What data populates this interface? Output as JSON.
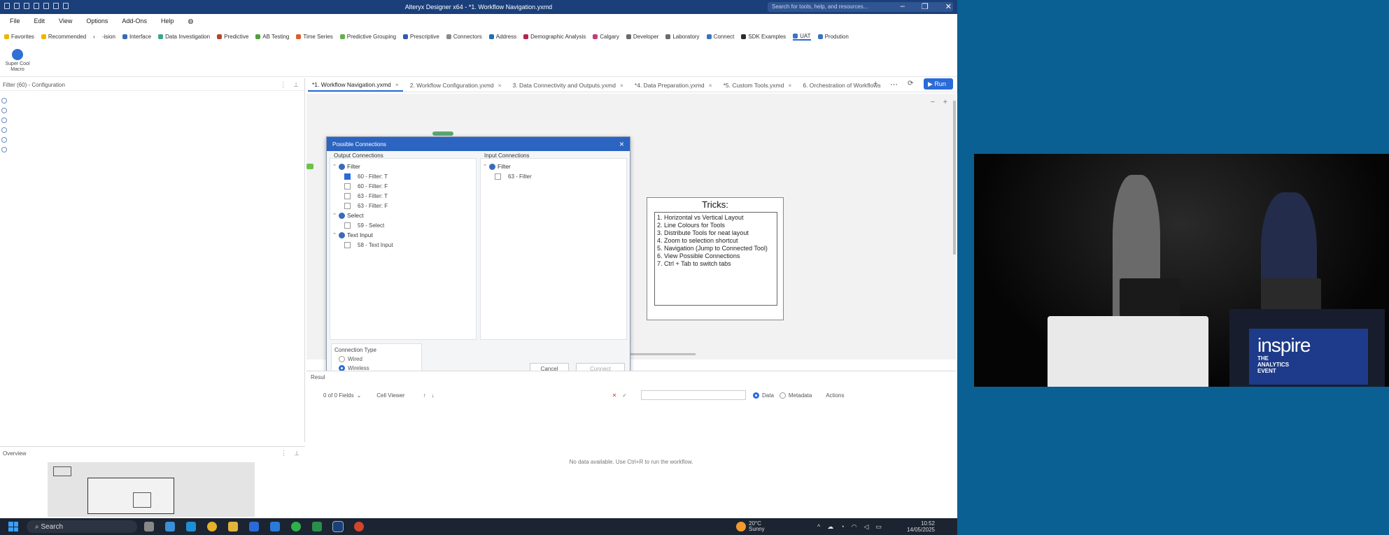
{
  "app": {
    "title": "Alteryx Designer x64 - *1. Workflow Navigation.yxmd",
    "search_placeholder": "Search for tools, help, and resources...",
    "window_controls": [
      "–",
      "❐",
      "✕"
    ]
  },
  "menu": [
    "File",
    "Edit",
    "View",
    "Options",
    "Add-Ons",
    "Help"
  ],
  "categories": [
    {
      "label": "Favorites",
      "color": "#f0b400"
    },
    {
      "label": "Recommended",
      "color": "#f0b400"
    },
    {
      "label": "‹"
    },
    {
      "label": "-ision",
      "color": ""
    },
    {
      "label": "Interface",
      "color": "#3b6bb8"
    },
    {
      "label": "Data Investigation",
      "color": "#3aa68c"
    },
    {
      "label": "Predictive",
      "color": "#b5462a"
    },
    {
      "label": "AB Testing",
      "color": "#4fa13a"
    },
    {
      "label": "Time Series",
      "color": "#e05a2b"
    },
    {
      "label": "Predictive Grouping",
      "color": "#62b04b"
    },
    {
      "label": "Prescriptive",
      "color": "#3556b8"
    },
    {
      "label": "Connectors",
      "color": "#8a8a8a"
    },
    {
      "label": "Address",
      "color": "#1f6fb0"
    },
    {
      "label": "Demographic Analysis",
      "color": "#b8234a"
    },
    {
      "label": "Calgary",
      "color": "#c13f7c"
    },
    {
      "label": "Developer",
      "color": "#6b6b6b"
    },
    {
      "label": "Laboratory",
      "color": "#6b6b6b"
    },
    {
      "label": "Connect",
      "color": "#3a73c2"
    },
    {
      "label": "SDK Examples",
      "color": "#2d2d2d"
    },
    {
      "label": "UAT",
      "color": "#3a73c2",
      "active": true
    },
    {
      "label": "Prodution",
      "color": "#3a73c2"
    }
  ],
  "palette": {
    "macro_label": "Super Cool Macro"
  },
  "config_panel": {
    "title": "Filter (60) - Configuration"
  },
  "overview": {
    "title": "Overview"
  },
  "tabs": [
    {
      "label": "*1. Workflow Navigation.yxmd",
      "active": true
    },
    {
      "label": "2. Workflow Configuration.yxmd"
    },
    {
      "label": "3. Data Connectivity and Outputs.yxmd"
    },
    {
      "label": "*4. Data Preparation.yxmd"
    },
    {
      "label": "*5. Custom Tools.yxmd"
    },
    {
      "label": "6. Orchestration of Workflows"
    }
  ],
  "run_label": "Run",
  "dialog": {
    "title": "Possible Connections",
    "output_header": "Output Connections",
    "input_header": "Input Connections",
    "output_groups": [
      {
        "name": "Filter",
        "items": [
          {
            "label": "60 - Filter: T",
            "checked": true
          },
          {
            "label": "60 - Filter: F",
            "checked": false
          },
          {
            "label": "63 - Filter: T",
            "checked": false
          },
          {
            "label": "63 - Filter: F",
            "checked": false
          }
        ]
      },
      {
        "name": "Select",
        "items": [
          {
            "label": "59 - Select",
            "checked": false
          }
        ]
      },
      {
        "name": "Text Input",
        "items": [
          {
            "label": "58 - Text Input",
            "checked": false
          }
        ]
      }
    ],
    "input_groups": [
      {
        "name": "Filter",
        "items": [
          {
            "label": "63 - Filter",
            "checked": false
          }
        ]
      }
    ],
    "connection_type_label": "Connection Type",
    "wired_label": "Wired",
    "wireless_label": "Wireless",
    "selected_type": "Wireless",
    "cancel_label": "Cancel",
    "connect_label": "Connect"
  },
  "tricks": {
    "title": "Tricks:",
    "items": [
      "1. Horizontal vs Vertical Layout",
      "2. Line Colours for Tools",
      "3. Distribute Tools for neat layout",
      "4. Zoom to selection shortcut",
      "5. Navigation (Jump to Connected Tool)",
      "6. View Possible Connections",
      "7. Ctrl + Tab to switch tabs"
    ]
  },
  "results": {
    "header": "Resul",
    "fields": "0 of 0 Fields",
    "cell_viewer": "Cell Viewer",
    "data_label": "Data",
    "metadata_label": "Metadata",
    "actions_label": "Actions",
    "empty_message": "No data available. Use Ctrl+R to run the workflow."
  },
  "taskbar": {
    "search": "Search",
    "temperature": "20°C",
    "condition": "Sunny",
    "time": "10:52",
    "date": "14/05/2025"
  },
  "video": {
    "brand_big": "inspire",
    "brand_line1": "THE",
    "brand_line2": "ANALYTICS",
    "brand_line3": "EVENT"
  }
}
